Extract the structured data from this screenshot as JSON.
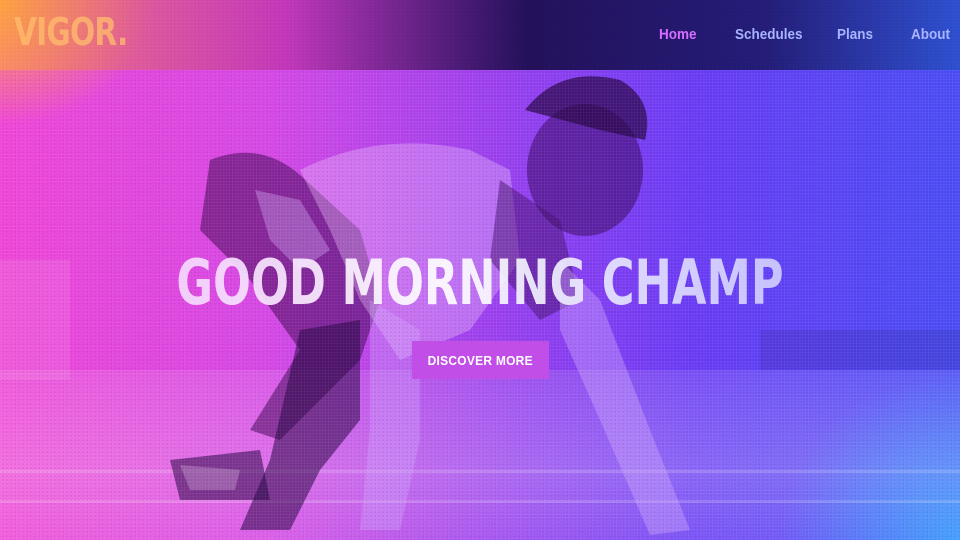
{
  "brand": {
    "logo_text": "VIGOR."
  },
  "nav": {
    "items": [
      {
        "label": "Home",
        "active": true
      },
      {
        "label": "Schedules",
        "active": false
      },
      {
        "label": "Plans",
        "active": false
      },
      {
        "label": "About",
        "active": false
      }
    ]
  },
  "hero": {
    "headline": "GOOD MORNING CHAMP",
    "cta_label": "DISCOVER MORE",
    "image_subject": "sprinter in starting crouch"
  },
  "colors": {
    "gradient_left": "#f046d8",
    "gradient_right": "#4a4df6",
    "accent_orange": "#ffaa3c",
    "accent_blue": "#2896ff",
    "nav_active": "#d66dff",
    "nav_inactive": "#a8b4ff",
    "cta_background": "#c24ee8"
  }
}
